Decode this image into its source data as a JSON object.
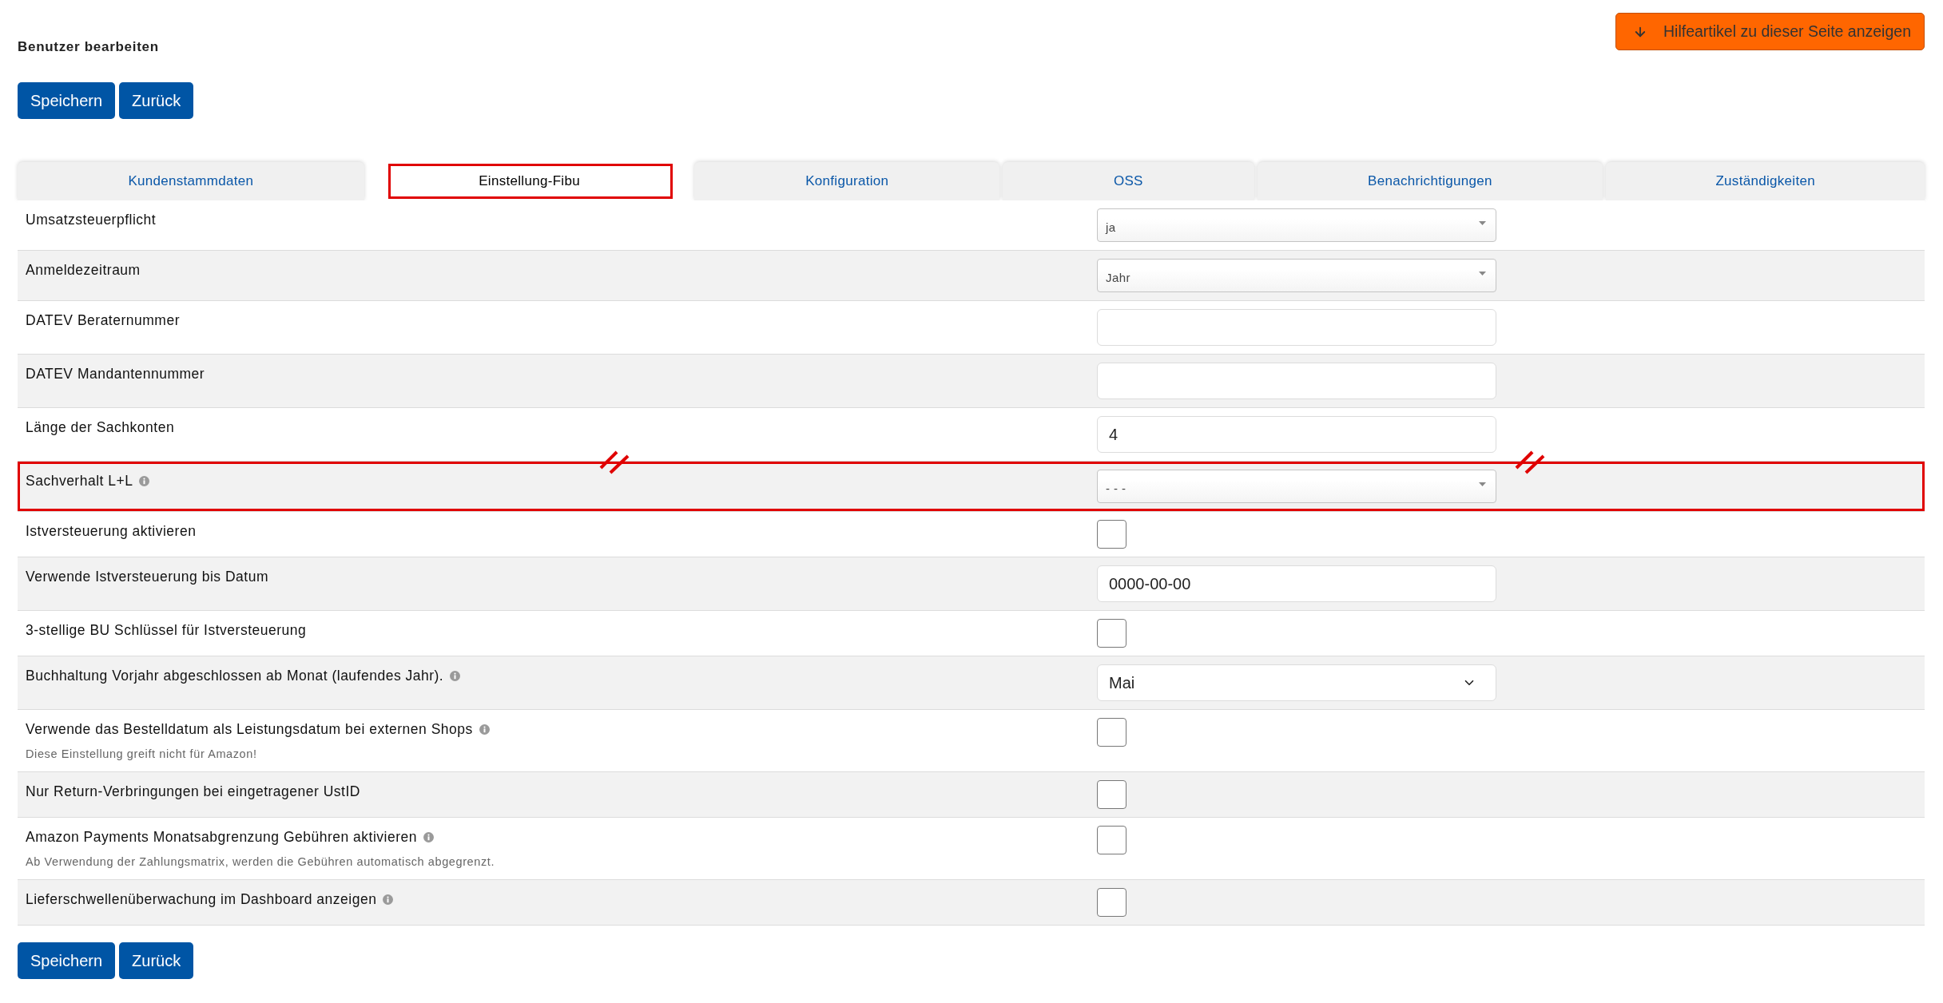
{
  "page": {
    "title": "Benutzer bearbeiten"
  },
  "help_button": {
    "label": "Hilfeartikel zu dieser Seite anzeigen"
  },
  "top_actions": [
    {
      "label": "Speichern"
    },
    {
      "label": "Zurück"
    }
  ],
  "tabs": [
    {
      "label": "Kundenstammdaten",
      "selected": false,
      "highlighted": false
    },
    {
      "label": "Einstellung-Fibu",
      "selected": true,
      "highlighted": true
    },
    {
      "label": "Konfiguration",
      "selected": false,
      "highlighted": false
    },
    {
      "label": "OSS",
      "selected": false,
      "highlighted": false
    },
    {
      "label": "Benachrichtigungen",
      "selected": false,
      "highlighted": false
    },
    {
      "label": "Zuständigkeiten",
      "selected": false,
      "highlighted": false
    }
  ],
  "settings": [
    {
      "label": "Umsatzsteuerpflicht",
      "info": false,
      "highlighted": false,
      "control": {
        "kind": "dropdown",
        "value": "ja"
      }
    },
    {
      "label": "Anmeldezeitraum",
      "info": false,
      "highlighted": false,
      "control": {
        "kind": "dropdown",
        "value": "Jahr"
      }
    },
    {
      "label": "DATEV Beraternummer",
      "info": false,
      "highlighted": false,
      "control": {
        "kind": "input"
      }
    },
    {
      "label": "DATEV Mandantennummer",
      "info": false,
      "highlighted": false,
      "control": {
        "kind": "input"
      }
    },
    {
      "label": "Länge der Sachkonten",
      "info": false,
      "highlighted": false,
      "control": {
        "kind": "input",
        "value": "4"
      }
    },
    {
      "label": "Sachverhalt L+L",
      "info": true,
      "highlighted": true,
      "control": {
        "kind": "dropdown",
        "value": "- - -"
      }
    },
    {
      "label": "Istversteuerung aktivieren",
      "info": false,
      "highlighted": false,
      "control": {
        "kind": "checkbox",
        "checked": false
      }
    },
    {
      "label": "Verwende Istversteuerung bis Datum",
      "info": false,
      "highlighted": false,
      "control": {
        "kind": "input",
        "value": "0000-00-00"
      }
    },
    {
      "label": "3-stellige BU Schlüssel für Istversteuerung",
      "info": false,
      "highlighted": false,
      "control": {
        "kind": "checkbox",
        "checked": false
      }
    },
    {
      "label": "Buchhaltung Vorjahr abgeschlossen ab Monat (laufendes Jahr).",
      "info": true,
      "highlighted": false,
      "control": {
        "kind": "select",
        "value": "Mai"
      }
    },
    {
      "label": "Verwende das Bestelldatum als Leistungsdatum bei externen Shops",
      "info": true,
      "highlighted": false,
      "note": "Diese Einstellung greift nicht für Amazon!",
      "control": {
        "kind": "checkbox",
        "checked": false
      }
    },
    {
      "label": "Nur Return-Verbringungen bei eingetragener UstID",
      "info": false,
      "highlighted": false,
      "control": {
        "kind": "checkbox",
        "checked": false
      }
    },
    {
      "label": "Amazon Payments Monatsabgrenzung Gebühren aktivieren",
      "info": true,
      "highlighted": false,
      "note": "Ab Verwendung der Zahlungsmatrix, werden die Gebühren automatisch abgegrenzt.",
      "control": {
        "kind": "checkbox",
        "checked": false
      }
    },
    {
      "label": "Lieferschwellenüberwachung im Dashboard anzeigen",
      "info": true,
      "highlighted": false,
      "control": {
        "kind": "checkbox",
        "checked": false
      }
    }
  ],
  "bottom_actions": [
    {
      "label": "Speichern"
    },
    {
      "label": "Zurück"
    }
  ]
}
